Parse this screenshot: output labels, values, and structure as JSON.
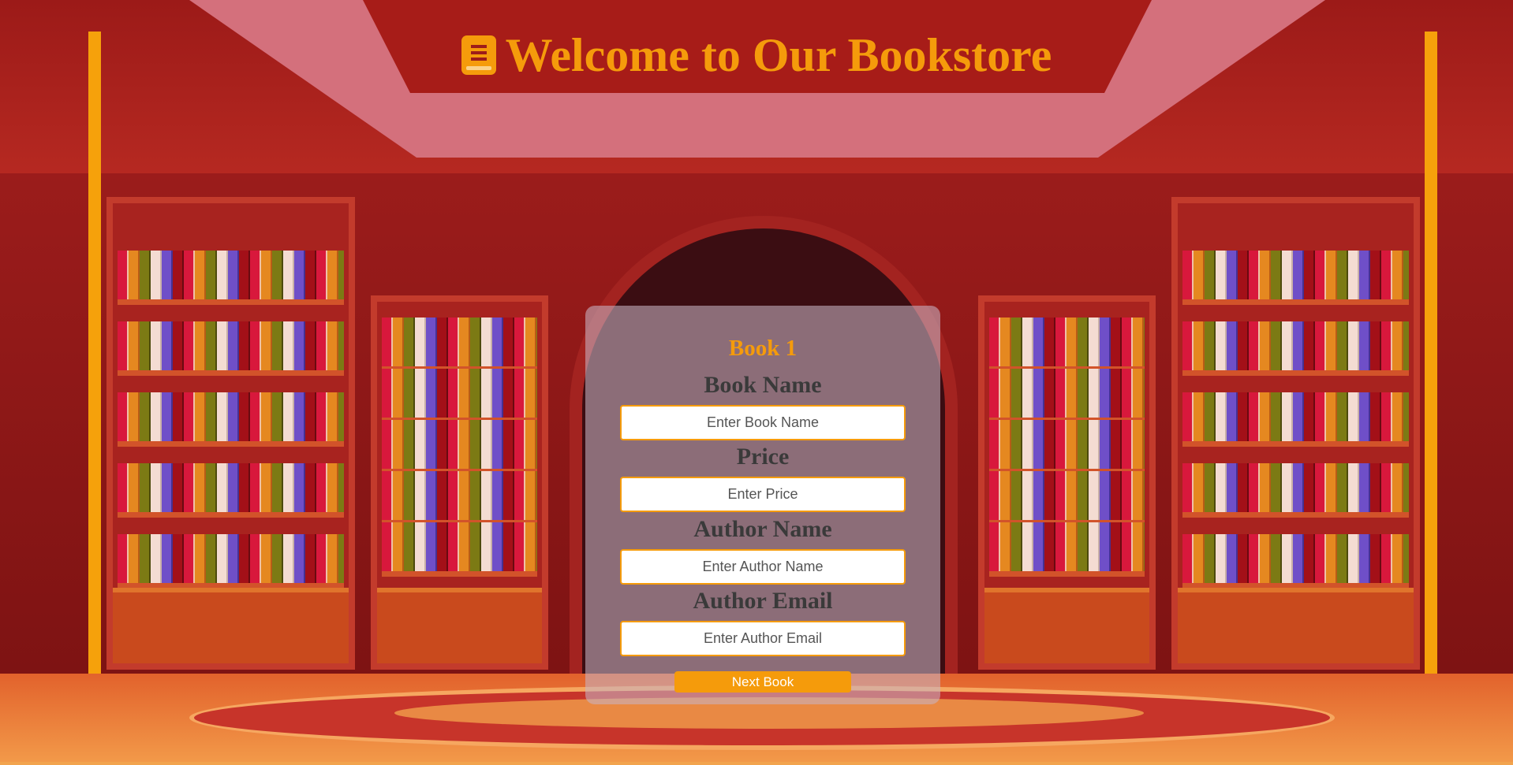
{
  "header": {
    "title": "Welcome to Our Bookstore",
    "icon": "book-icon"
  },
  "form": {
    "book_heading": "Book 1",
    "fields": [
      {
        "label": "Book Name",
        "placeholder": "Enter Book Name"
      },
      {
        "label": "Price",
        "placeholder": "Enter Price"
      },
      {
        "label": "Author Name",
        "placeholder": "Enter Author Name"
      },
      {
        "label": "Author Email",
        "placeholder": "Enter Author Email"
      }
    ],
    "submit_label": "Next Book"
  },
  "colors": {
    "accent": "#f59b0b",
    "label_text": "#3a3a3a",
    "background": "#8a1414"
  }
}
